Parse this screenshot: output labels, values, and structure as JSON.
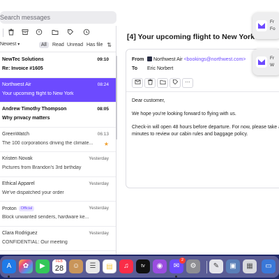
{
  "search": {
    "placeholder": "Search messages"
  },
  "toolbar": {
    "icons": [
      "trash-icon",
      "archive-icon",
      "spam-icon",
      "move-folder-icon",
      "label-icon",
      "snooze-clock-icon"
    ]
  },
  "filters": {
    "sort_label": "Newest",
    "items": [
      "All",
      "Read",
      "Unread",
      "Has file"
    ],
    "active": "All"
  },
  "messages": [
    {
      "sender": "NewTec Solutions",
      "subject": "Re: Invoice #1605",
      "time": "09:10",
      "unread": true,
      "selected": false
    },
    {
      "sender": "Northwest Air",
      "subject": "Your upcoming flight to New York",
      "time": "08:24",
      "unread": false,
      "selected": true
    },
    {
      "sender": "Andrew Timothy Thompson",
      "subject": "Why privacy matters",
      "time": "08:05",
      "unread": true,
      "selected": false
    },
    {
      "sender": "GreenWatch",
      "subject": "The 100 corporations driving the climate...",
      "time": "06:13",
      "unread": false,
      "selected": false,
      "starred": true
    },
    {
      "sender": "Kristen Novak",
      "subject": "Pictures from Brandon's 3rd birthday",
      "time": "Yesterday",
      "unread": false,
      "selected": false
    },
    {
      "sender": "Ethical Apparel",
      "subject": "We've dispatched your order",
      "time": "Yesterday",
      "unread": false,
      "selected": false
    },
    {
      "sender": "Proton",
      "badge": "Official",
      "subject": "Block unwanted senders, hardware ke...",
      "time": "Yesterday",
      "unread": false,
      "selected": false
    },
    {
      "sender": "Clara Rodriguez",
      "subject": "CONFIDENTIAL: Our meeting",
      "time": "Yesterday",
      "unread": false,
      "selected": false
    }
  ],
  "reader": {
    "title": "[4] Your upcoming flight to New York",
    "from_label": "From",
    "from_name": "Northwest Air",
    "from_email": "<bookings@northwest.com>",
    "to_label": "To",
    "to_name": "Eric Norbert",
    "body": [
      "Dear customer,",
      "We hope you're looking forward to flying with us.",
      "Check-in will open 48 hours before departure. For now, please take a",
      "minutes to review our cabin rules and baggage policy."
    ]
  },
  "notifications": [
    {
      "line1": "Fr",
      "line2": "Fo"
    },
    {
      "line1": "Fr",
      "line2": "W"
    }
  ],
  "dock": {
    "calendar_month": "FEB",
    "calendar_day": "28",
    "mail_badge": "2"
  },
  "colors": {
    "accent": "#6d4aff",
    "selected_row": "#6d4aff",
    "star": "#f0a030"
  }
}
